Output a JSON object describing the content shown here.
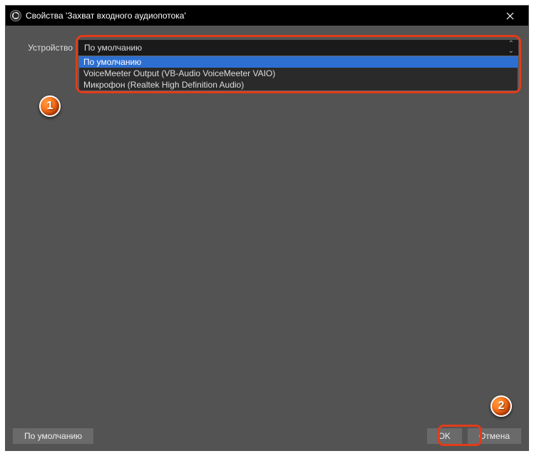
{
  "window": {
    "title": "Свойства 'Захват входного аудиопотока'"
  },
  "device": {
    "label": "Устройство",
    "selected": "По умолчанию",
    "options": [
      "По умолчанию",
      "VoiceMeeter Output (VB-Audio VoiceMeeter VAIO)",
      "Микрофон (Realtek High Definition Audio)"
    ]
  },
  "buttons": {
    "defaults": "По умолчанию",
    "ok": "OK",
    "cancel": "Отмена"
  },
  "markers": {
    "m1": "1",
    "m2": "2"
  },
  "colors": {
    "highlight": "#e23b1a",
    "selection": "#2d6fd1"
  }
}
